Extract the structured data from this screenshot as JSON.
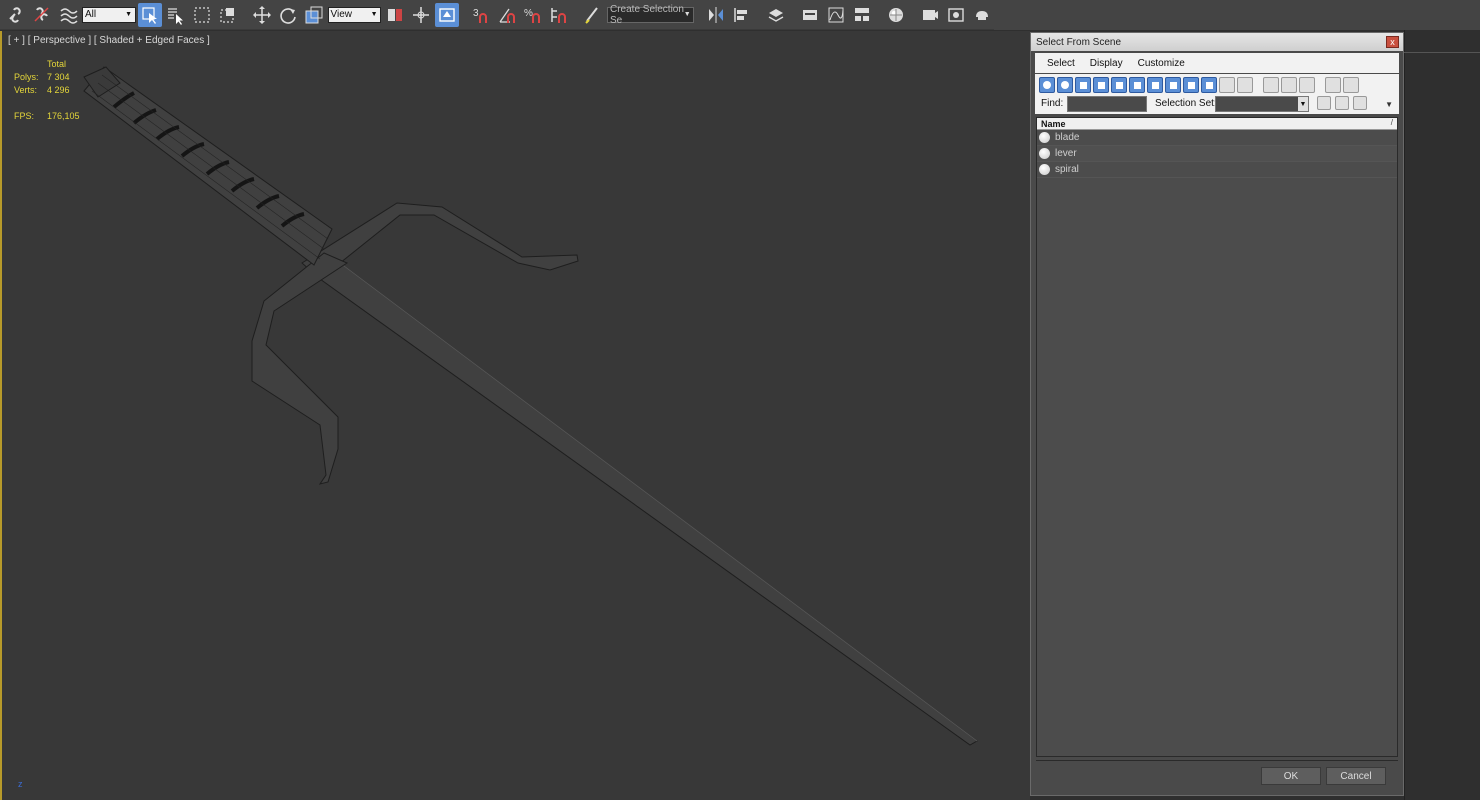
{
  "toolbar": {
    "filter_value": "All",
    "refcoord_value": "View",
    "named_selection_placeholder": "Create Selection Se",
    "snap_3_label": "3",
    "percent_snap_label": "%"
  },
  "viewport": {
    "label": "[ + ] [ Perspective ] [ Shaded + Edged Faces ]",
    "stats": {
      "total_label": "Total",
      "polys_label": "Polys:",
      "polys_value": "7 304",
      "verts_label": "Verts:",
      "verts_value": "4 296",
      "fps_label": "FPS:",
      "fps_value": "176,105"
    },
    "axis_label": "z"
  },
  "dialog": {
    "title": "Select From Scene",
    "close_glyph": "x",
    "menu": [
      "Select",
      "Display",
      "Customize"
    ],
    "find_label": "Find:",
    "find_value": "",
    "selection_set_label": "Selection Set:",
    "column_name": "Name",
    "sort_glyph": "/",
    "items": [
      "blade",
      "lever",
      "spiral"
    ],
    "ok_label": "OK",
    "cancel_label": "Cancel"
  },
  "colors": {
    "active_blue": "#5b8fd6",
    "stats_yellow": "#e4d63a",
    "viewport_border": "#b79a2a",
    "viewport_bg": "#383838"
  }
}
